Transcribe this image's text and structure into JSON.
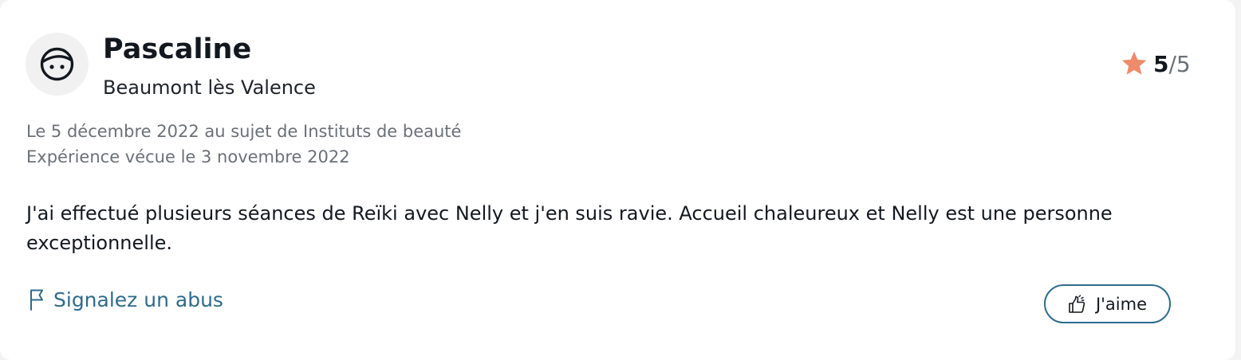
{
  "review": {
    "author": "Pascaline",
    "location": "Beaumont lès Valence",
    "rating": {
      "score": "5",
      "max": "/5"
    },
    "date_line": "Le 5 décembre 2022 au sujet de Instituts de beauté",
    "experience_line": "Expérience vécue le 3 novembre 2022",
    "comment": "J'ai effectué plusieurs séances de Reïki avec Nelly et j'en suis ravie. Accueil chaleureux et Nelly est une personne exceptionnelle."
  },
  "actions": {
    "report_label": "Signalez un abus",
    "like_label": "J'aime"
  },
  "icons": {
    "avatar": "face-avatar-icon",
    "rating": "star-icon",
    "report": "flag-icon",
    "like": "thumbs-up-icon"
  },
  "colors": {
    "star": "#ef8a6a",
    "link": "#2e6b8e",
    "text": "#13181f",
    "muted": "#6b7078"
  }
}
